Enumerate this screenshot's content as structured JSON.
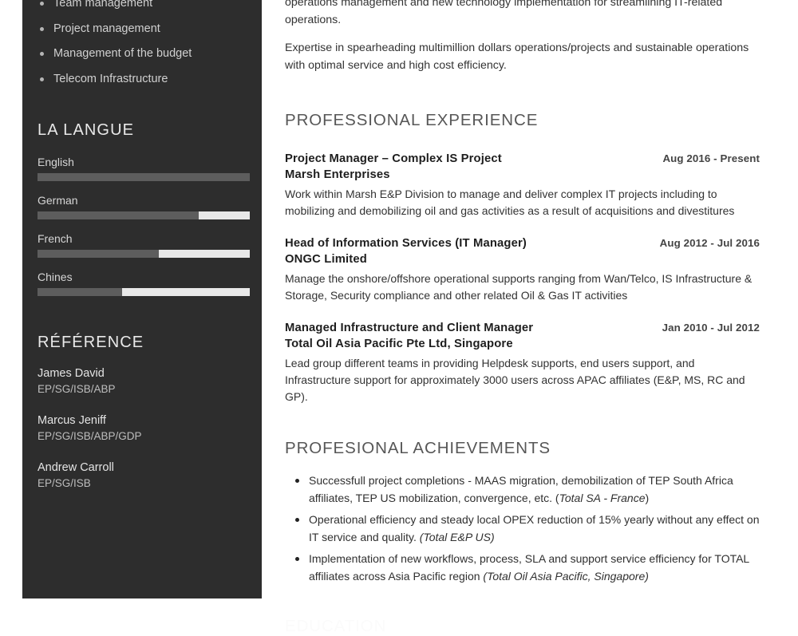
{
  "sidebar": {
    "skills": [
      "Team management",
      "Project management",
      "Management of the budget",
      "Telecom Infrastructure"
    ],
    "language_section_title": "LA LANGUE",
    "languages": [
      {
        "name": "English",
        "level": 100
      },
      {
        "name": "German",
        "level": 76
      },
      {
        "name": "French",
        "level": 57
      },
      {
        "name": "Chines",
        "level": 40
      }
    ],
    "reference_section_title": "RÉFÉRENCE",
    "references": [
      {
        "name": "James David",
        "detail": "EP/SG/ISB/ABP"
      },
      {
        "name": "Marcus Jeniff",
        "detail": "EP/SG/ISB/ABP/GDP"
      },
      {
        "name": "Andrew Carroll",
        "detail": "EP/SG/ISB"
      }
    ]
  },
  "main": {
    "intro_paragraphs": [
      "operations management and new technology implementation for streamlining IT-related operations.",
      "Expertise in spearheading multimillion dollars operations/projects and sustainable operations with optimal service and high cost efficiency."
    ],
    "experience_title": "PROFESSIONAL EXPERIENCE",
    "jobs": [
      {
        "title": "Project Manager – Complex IS Project",
        "company": "Marsh Enterprises",
        "date": "Aug 2016 - Present",
        "description": "Work within Marsh E&P Division to manage and deliver complex IT projects including  to mobilizing and demobilizing oil and gas activities as a result of acquisitions and divestitures"
      },
      {
        "title": "Head of Information Services (IT Manager)",
        "company": "ONGC Limited",
        "date": "Aug 2012 - Jul 2016",
        "description": "Manage the onshore/offshore operational supports ranging from Wan/Telco, IS Infrastructure & Storage, Security compliance and other related Oil & Gas IT activities"
      },
      {
        "title": "Managed Infrastructure and Client Manager",
        "company": "Total Oil Asia Pacific Pte Ltd, Singapore",
        "date": "Jan 2010 - Jul 2012",
        "description": "Lead group different teams in providing Helpdesk supports, end users support, and Infrastructure support for approximately 3000 users across APAC affiliates (E&P, MS, RC and GP)."
      }
    ],
    "achievements_title": "PROFESIONAL ACHIEVEMENTS",
    "achievements": [
      {
        "text": "Successfull project completions - MAAS migration, demobilization of TEP South Africa affiliates, TEP US mobilization, convergence, etc. (",
        "italic": "Total SA - France",
        "tail": ")"
      },
      {
        "text": "Operational efficiency and steady local OPEX reduction of 15% yearly without any effect on IT service and quality. ",
        "italic": "(Total E&P US)",
        "tail": ""
      },
      {
        "text": "Implementation of new workflows, process, SLA and support service efficiency for TOTAL affiliates across Asia Pacific region ",
        "italic": "(Total Oil Asia Pacific, Singapore)",
        "tail": ""
      }
    ],
    "next_section_title": "EDUCATION"
  },
  "colors": {
    "sidebar_bg": "#2d2d2d",
    "bar_filled": "#5d5d5d",
    "bar_track": "#e8e8e8",
    "heading": "#575757"
  }
}
